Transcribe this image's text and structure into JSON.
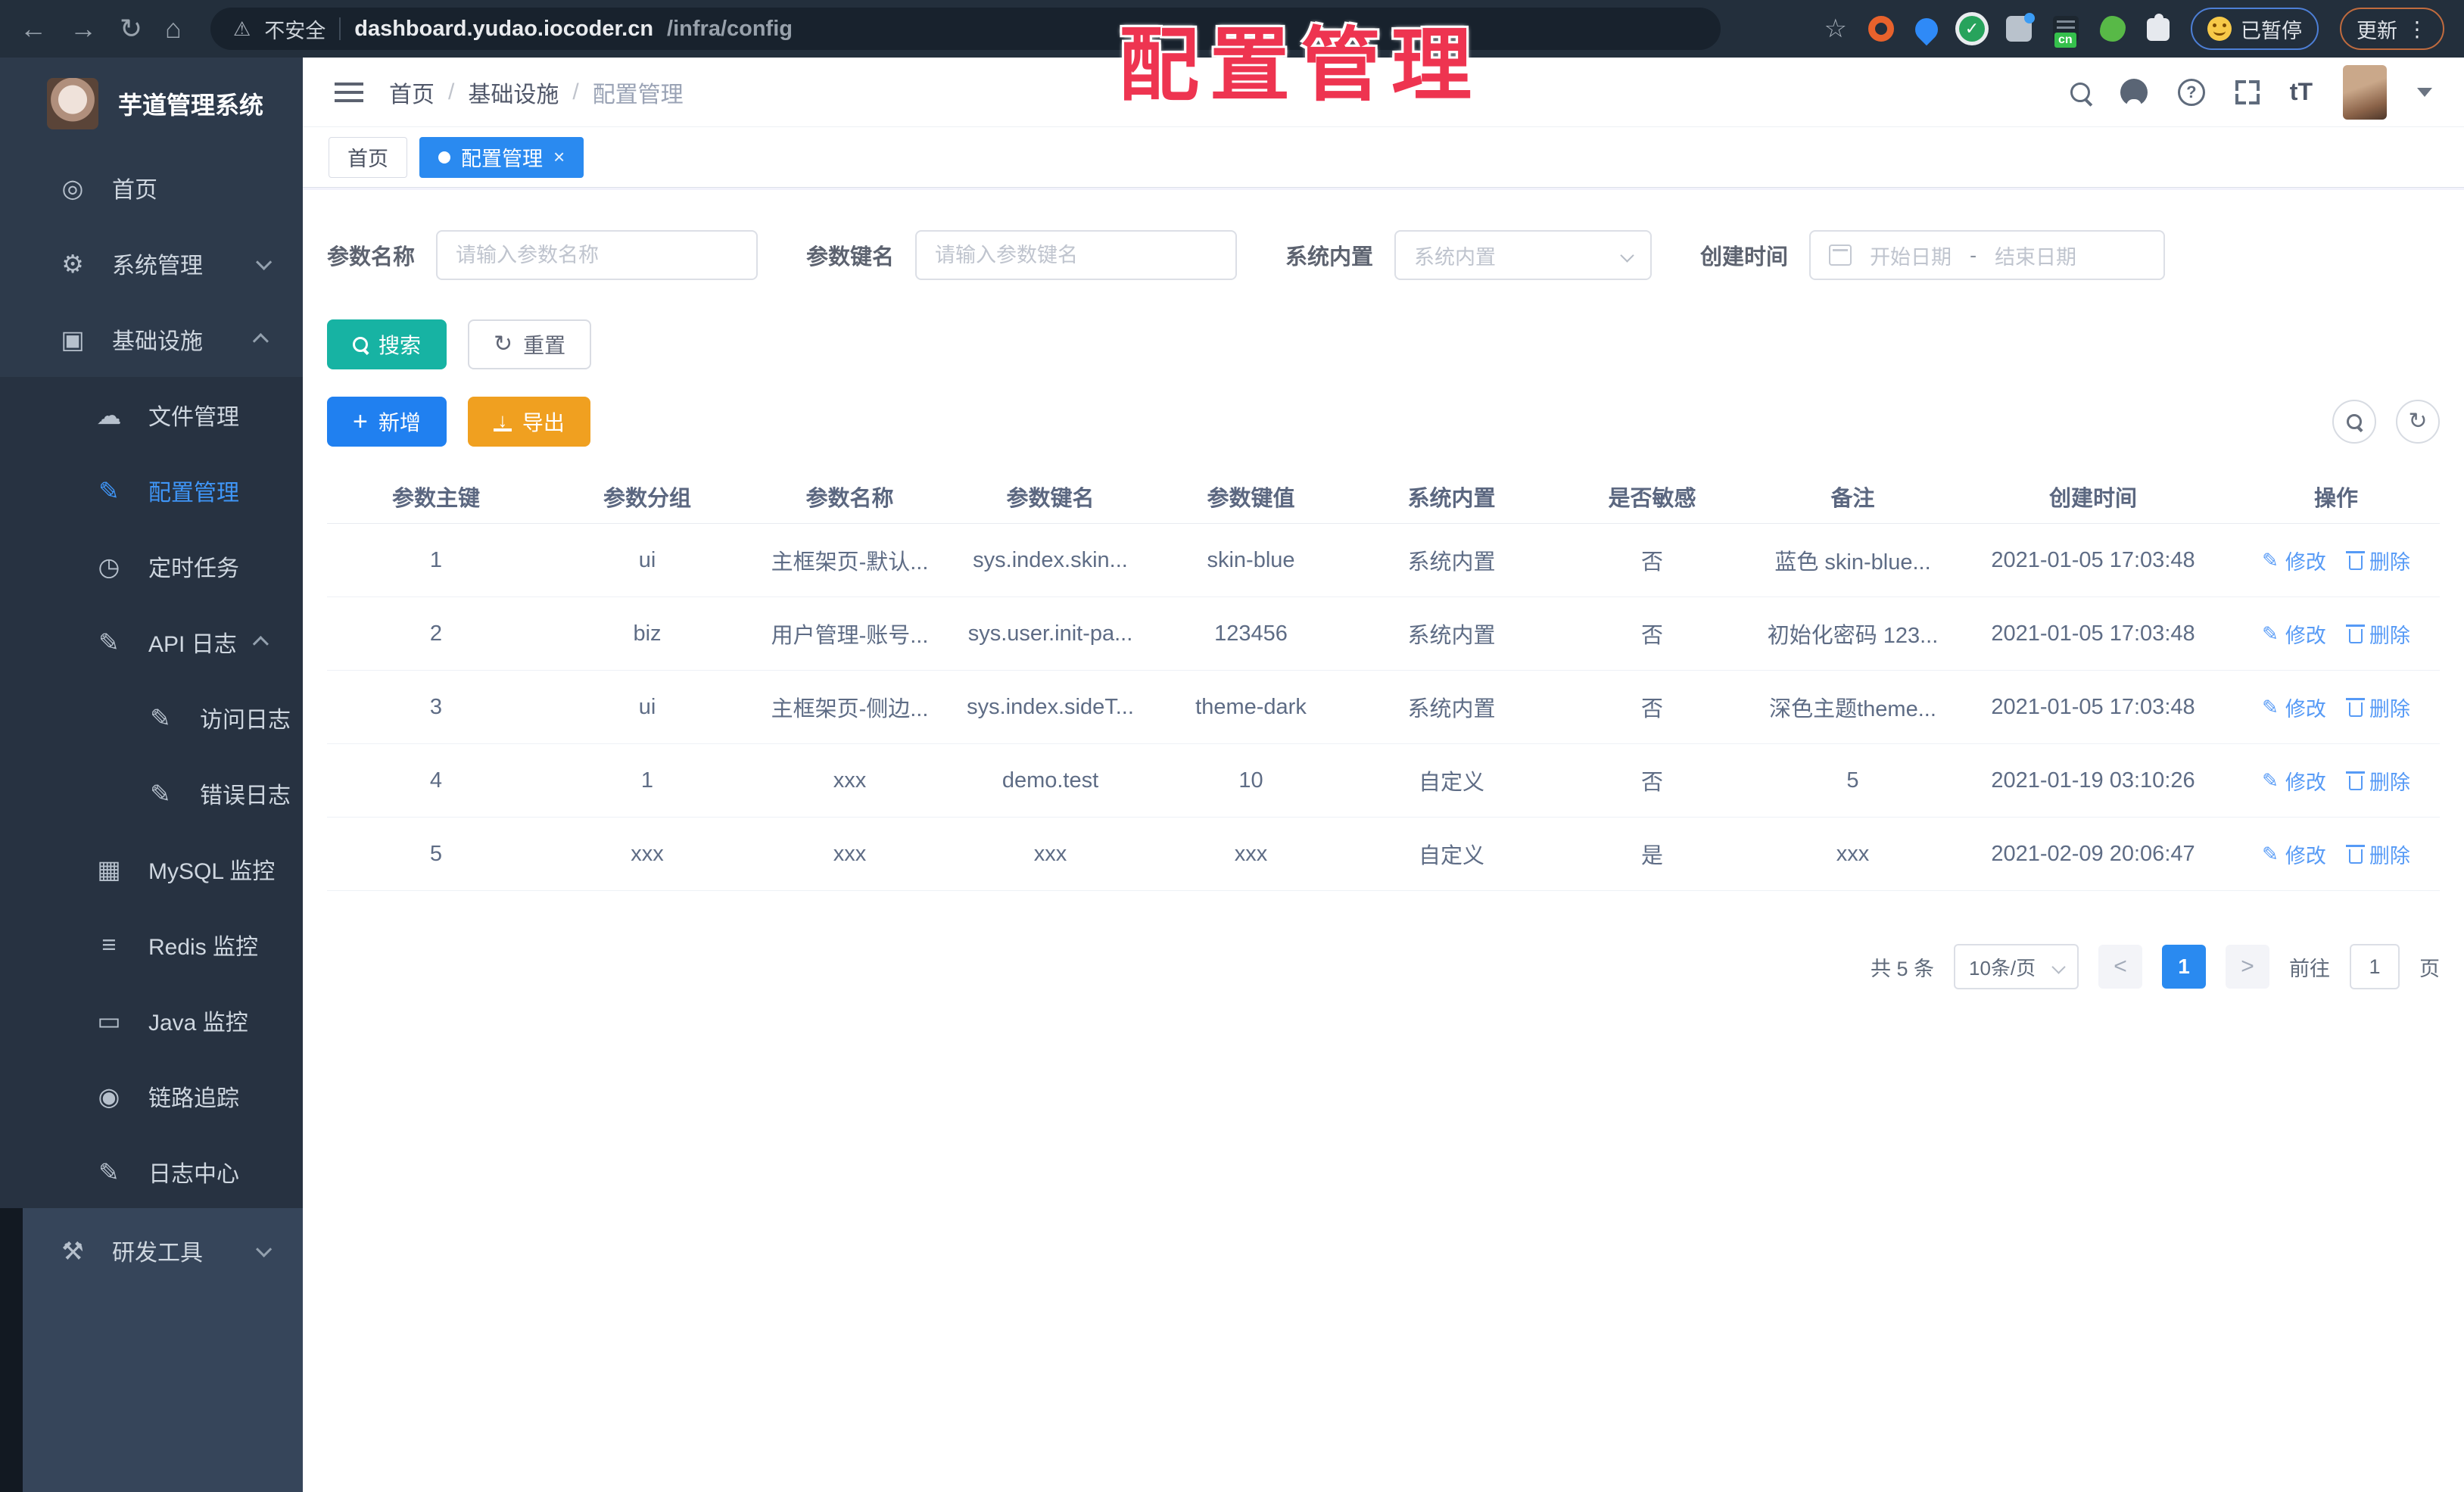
{
  "colors": {
    "accent_blue": "#2080f0",
    "active_tab_blue": "#2a8af0",
    "teal_search": "#17b3a3",
    "amber_export": "#f0a020",
    "sidebar_bg": "#2d3a4b",
    "sidebar_active": "#3f96f8",
    "annotation_red": "#ee3450",
    "link_blue": "#569af6"
  },
  "glyphs": {
    "back": "←",
    "forward": "→",
    "reload": "↻",
    "home": "⌂",
    "warning": "⚠",
    "star": "☆",
    "check": "✓",
    "help": "?",
    "font_size": "tT",
    "close": "×",
    "dot_menu": "⋮",
    "plus": "+",
    "down_arrow": "↓",
    "refresh": "↻",
    "pencil": "✎",
    "gauge": "◎",
    "gear": "⚙",
    "infra": "▣",
    "cloud": "☁",
    "clock": "◷",
    "grid": "▦",
    "stack": "≡",
    "monitor": "▭",
    "eye": "◉",
    "tools": "⚒",
    "slash": "/"
  },
  "browser": {
    "security_text": "不安全",
    "url_host": "dashboard.yudao.iocoder.cn",
    "url_path": "/infra/config",
    "cn_badge": "cn",
    "paused_badge": "已暂停",
    "update_button": "更新"
  },
  "annotation": {
    "title": "配置管理"
  },
  "sidebar": {
    "title": "芋道管理系统",
    "items": [
      {
        "label": "首页"
      },
      {
        "label": "系统管理"
      },
      {
        "label": "基础设施"
      },
      {
        "label": "文件管理"
      },
      {
        "label": "配置管理"
      },
      {
        "label": "定时任务"
      },
      {
        "label": "API 日志"
      },
      {
        "label": "访问日志"
      },
      {
        "label": "错误日志"
      },
      {
        "label": "MySQL 监控"
      },
      {
        "label": "Redis 监控"
      },
      {
        "label": "Java 监控"
      },
      {
        "label": "链路追踪"
      },
      {
        "label": "日志中心"
      },
      {
        "label": "研发工具"
      }
    ]
  },
  "header": {
    "breadcrumb": [
      "首页",
      "基础设施",
      "配置管理"
    ]
  },
  "tabs": [
    {
      "label": "首页"
    },
    {
      "label": "配置管理"
    }
  ],
  "filters": {
    "name_label": "参数名称",
    "name_ph": "请输入参数名称",
    "key_label": "参数键名",
    "key_ph": "请输入参数键名",
    "type_label": "系统内置",
    "type_ph": "系统内置",
    "date_label": "创建时间",
    "date_start_ph": "开始日期",
    "date_sep": "-",
    "date_end_ph": "结束日期",
    "search_label": "搜索",
    "reset_label": "重置"
  },
  "toolbar": {
    "add_label": "新增",
    "export_label": "导出"
  },
  "table": {
    "columns": [
      "参数主键",
      "参数分组",
      "参数名称",
      "参数键名",
      "参数键值",
      "系统内置",
      "是否敏感",
      "备注",
      "创建时间",
      "操作"
    ],
    "edit_label": "修改",
    "delete_label": "删除",
    "rows": [
      [
        "1",
        "ui",
        "主框架页-默认...",
        "sys.index.skin...",
        "skin-blue",
        "系统内置",
        "否",
        "蓝色 skin-blue...",
        "2021-01-05 17:03:48"
      ],
      [
        "2",
        "biz",
        "用户管理-账号...",
        "sys.user.init-pa...",
        "123456",
        "系统内置",
        "否",
        "初始化密码 123...",
        "2021-01-05 17:03:48"
      ],
      [
        "3",
        "ui",
        "主框架页-侧边...",
        "sys.index.sideT...",
        "theme-dark",
        "系统内置",
        "否",
        "深色主题theme...",
        "2021-01-05 17:03:48"
      ],
      [
        "4",
        "1",
        "xxx",
        "demo.test",
        "10",
        "自定义",
        "否",
        "5",
        "2021-01-19 03:10:26"
      ],
      [
        "5",
        "xxx",
        "xxx",
        "xxx",
        "xxx",
        "自定义",
        "是",
        "xxx",
        "2021-02-09 20:06:47"
      ]
    ]
  },
  "pagination": {
    "total": "共 5 条",
    "page_size": "10条/页",
    "prev": "<",
    "page": "1",
    "next": ">",
    "goto_label": "前往",
    "goto_value": "1",
    "unit_label": "页"
  }
}
